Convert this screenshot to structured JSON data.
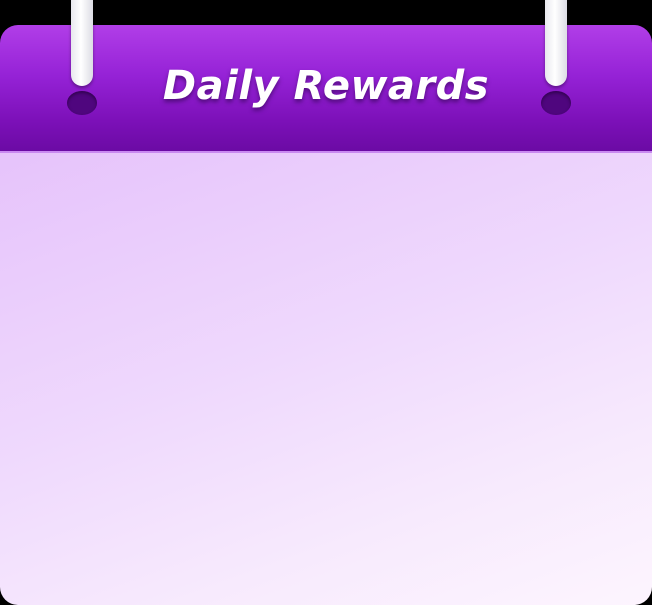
{
  "calendar": {
    "title": "Daily Rewards",
    "colors": {
      "header_top": "#b13ee8",
      "header_bottom": "#6a0aa3",
      "body_start": "#e6c3fb",
      "body_end": "#fdf5fe",
      "ring": "#ffffff"
    }
  }
}
